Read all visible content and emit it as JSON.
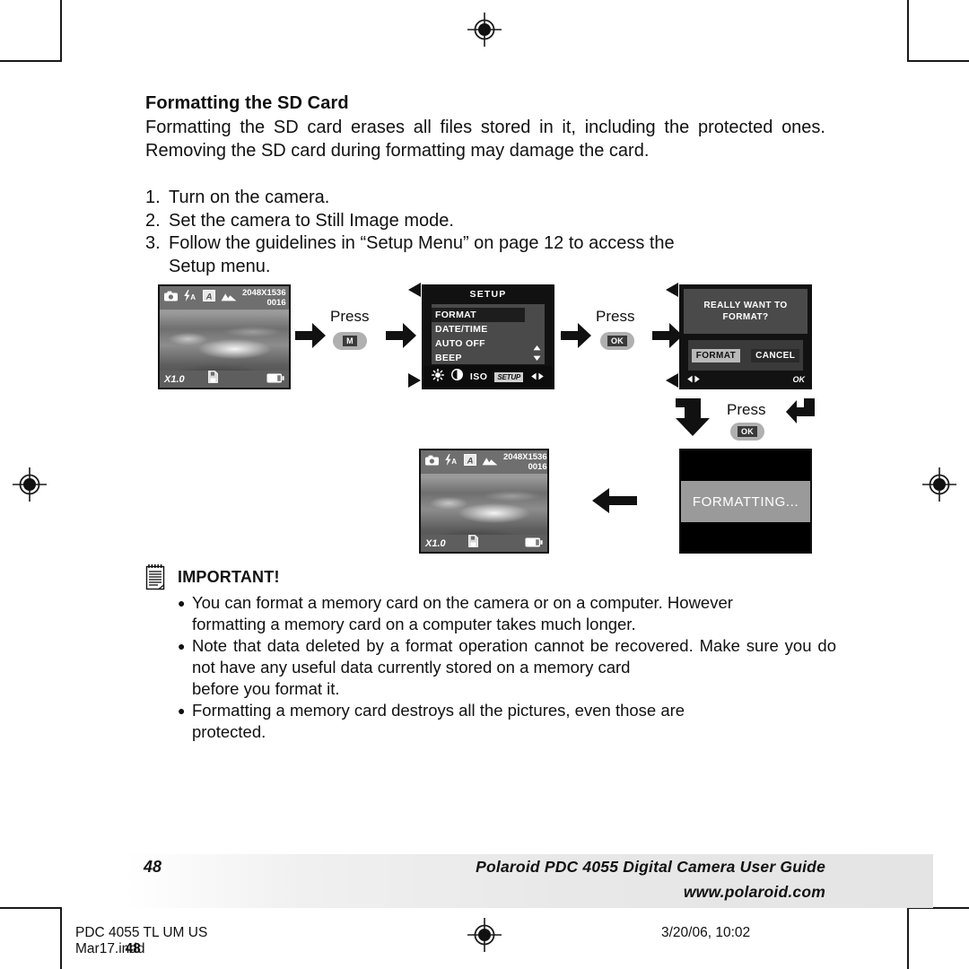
{
  "doc": {
    "heading": "Formatting the SD Card",
    "intro": "Formatting the SD card erases all files stored in it, including the protected ones. Removing the SD card during formatting may damage the card.",
    "steps": [
      {
        "num": "1.",
        "text": "Turn on the camera."
      },
      {
        "num": "2.",
        "text": "Set the camera to Still Image mode."
      },
      {
        "num": "3.",
        "text": "Follow the guidelines in “Setup Menu” on page 12 to access the",
        "text2": "Setup menu."
      }
    ]
  },
  "diagram": {
    "press_label": "Press",
    "key_menu": "M",
    "key_ok": "OK",
    "liveview": {
      "resolution": "2048X1536",
      "shots_remaining": "0016",
      "zoom": "X1.0",
      "icons": [
        "camera-icon",
        "flash-auto-icon",
        "white-balance-auto-icon",
        "landscape-mode-icon",
        "sd-card-icon",
        "battery-icon"
      ]
    },
    "setup_menu": {
      "title": "SETUP",
      "items": [
        "FORMAT",
        "DATE/TIME",
        "AUTO OFF",
        "BEEP"
      ],
      "selected": "FORMAT",
      "tabs": [
        "brightness-icon",
        "contrast-icon",
        "ISO",
        "SETUP",
        "left-right-arrows-icon"
      ],
      "tab_setup_label": "SETUP",
      "tab_iso_label": "ISO"
    },
    "confirm": {
      "line1": "REALLY WANT TO",
      "line2": "FORMAT?",
      "button_format": "FORMAT",
      "button_cancel": "CANCEL",
      "hint_left": "◀▶",
      "hint_right": "OK"
    },
    "formatting": {
      "message": "FORMATTING..."
    }
  },
  "important": {
    "title": "IMPORTANT!",
    "bullets": [
      {
        "text": "You can format a memory card on the camera or on a computer. However",
        "last": "formatting a memory card on a computer takes much longer."
      },
      {
        "text": "Note that data deleted by a format operation cannot be recovered. Make sure you do not have any useful data currently stored on a memory card",
        "last": "before you format it."
      },
      {
        "text": "Formatting a memory card destroys all the pictures, even those are",
        "last": "protected."
      }
    ]
  },
  "footer": {
    "page_number": "48",
    "guide_title": "Polaroid PDC 4055 Digital Camera User Guide",
    "website": "www.polaroid.com",
    "print_file": "PDC 4055 TL UM US Mar17.indd",
    "print_overlay": "48",
    "print_timestamp": "3/20/06, 10:02"
  },
  "colors": {
    "ink": "#111111",
    "lcd_dark": "#111111",
    "lcd_panel": "#4a4a4a",
    "keycap": "#b0b0b0",
    "footer_band": "#e8e8e8"
  }
}
